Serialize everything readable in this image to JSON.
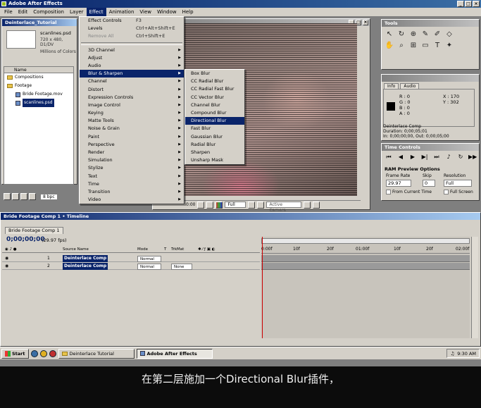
{
  "app": {
    "title": "Adobe After Effects"
  },
  "menubar": [
    "File",
    "Edit",
    "Composition",
    "Layer",
    "Effect",
    "Animation",
    "View",
    "Window",
    "Help"
  ],
  "effect_menu": {
    "top_items": [
      {
        "label": "Effect Controls",
        "shortcut": "F3"
      },
      {
        "label": "Levels",
        "shortcut": "Ctrl+Alt+Shift+E"
      },
      {
        "label": "Remove All",
        "shortcut": "Ctrl+Shift+E"
      }
    ],
    "items": [
      "3D Channel",
      "Adjust",
      "Audio",
      "Blur & Sharpen",
      "Channel",
      "Distort",
      "Expression Controls",
      "Image Control",
      "Keying",
      "Matte Tools",
      "Noise & Grain",
      "Paint",
      "Perspective",
      "Render",
      "Simulation",
      "Stylize",
      "Text",
      "Time",
      "Transition",
      "Video"
    ],
    "highlighted": "Blur & Sharpen"
  },
  "blur_submenu": {
    "items": [
      "Box Blur",
      "CC Radial Blur",
      "CC Radial Fast Blur",
      "CC Vector Blur",
      "Channel Blur",
      "Compound Blur",
      "Directional Blur",
      "Fast Blur",
      "Gaussian Blur",
      "Radial Blur",
      "Sharpen",
      "Unsharp Mask"
    ],
    "highlighted": "Directional Blur"
  },
  "project": {
    "title": "Deinterlace_Tutorial",
    "file_name": "scanlines.psd",
    "file_info": "720 x 480, D1/DV",
    "file_info2": "Millions of Colors",
    "column": "Name",
    "items": [
      {
        "label": "Compositions",
        "type": "folder"
      },
      {
        "label": "Footage",
        "type": "folder"
      },
      {
        "label": "Bride Footage.mov",
        "type": "file"
      },
      {
        "label": "scanlines.psd",
        "type": "file",
        "selected": true
      }
    ],
    "bpc": "8 bpc"
  },
  "viewer": {
    "zoom": "Full",
    "camera": "Active Camera",
    "timecode": "0:00"
  },
  "tools": {
    "title": "Tools",
    "icons": [
      "arrow",
      "rotate",
      "camera-orbit",
      "pen",
      "pan",
      "text"
    ]
  },
  "info": {
    "tabs": [
      "Info",
      "Audio"
    ],
    "r": "R : 0",
    "g": "G : 0",
    "b": "B : 0",
    "a": "A : 0",
    "x": "X : 170",
    "y": "Y : 302",
    "lines": [
      "Deinterlace Comp",
      "Duration: 0;00;05;01",
      "In: 0;00;00;00, Out: 0;00;05;00"
    ]
  },
  "time_controls": {
    "title": "Time Controls",
    "ram_title": "RAM Preview Options",
    "frame_rate_label": "Frame Rate",
    "skip_label": "Skip",
    "resolution_label": "Resolution",
    "frame_rate": "29.97",
    "skip": "0",
    "resolution": "Full",
    "from_current": "From Current Time",
    "full_screen": "Full Screen"
  },
  "timeline": {
    "title": "Bride Footage Comp 1 • Timeline",
    "tab": "Bride Footage Comp 1",
    "time": "0;00;00;00",
    "fps": "(29.97 fps)",
    "headers": {
      "source": "Source Name",
      "mode": "Mode",
      "t": "T",
      "trkmat": "TrkMat"
    },
    "layers": [
      {
        "num": "1",
        "name": "Deinterlace Comp",
        "mode": "Normal",
        "trkmat": ""
      },
      {
        "num": "2",
        "name": "Deinterlace Comp",
        "mode": "Normal",
        "trkmat": "None"
      }
    ],
    "ruler": [
      "0:00f",
      "10f",
      "20f",
      "01:00f",
      "10f",
      "20f",
      "02:00f"
    ]
  },
  "taskbar": {
    "start": "Start",
    "tasks": [
      {
        "label": "Deinterlace Tutorial",
        "active": false
      },
      {
        "label": "Adobe After Effects",
        "active": true
      }
    ],
    "clock": "9:30 AM"
  },
  "subtitle": "在第二层施加一个Directional Blur插件，"
}
